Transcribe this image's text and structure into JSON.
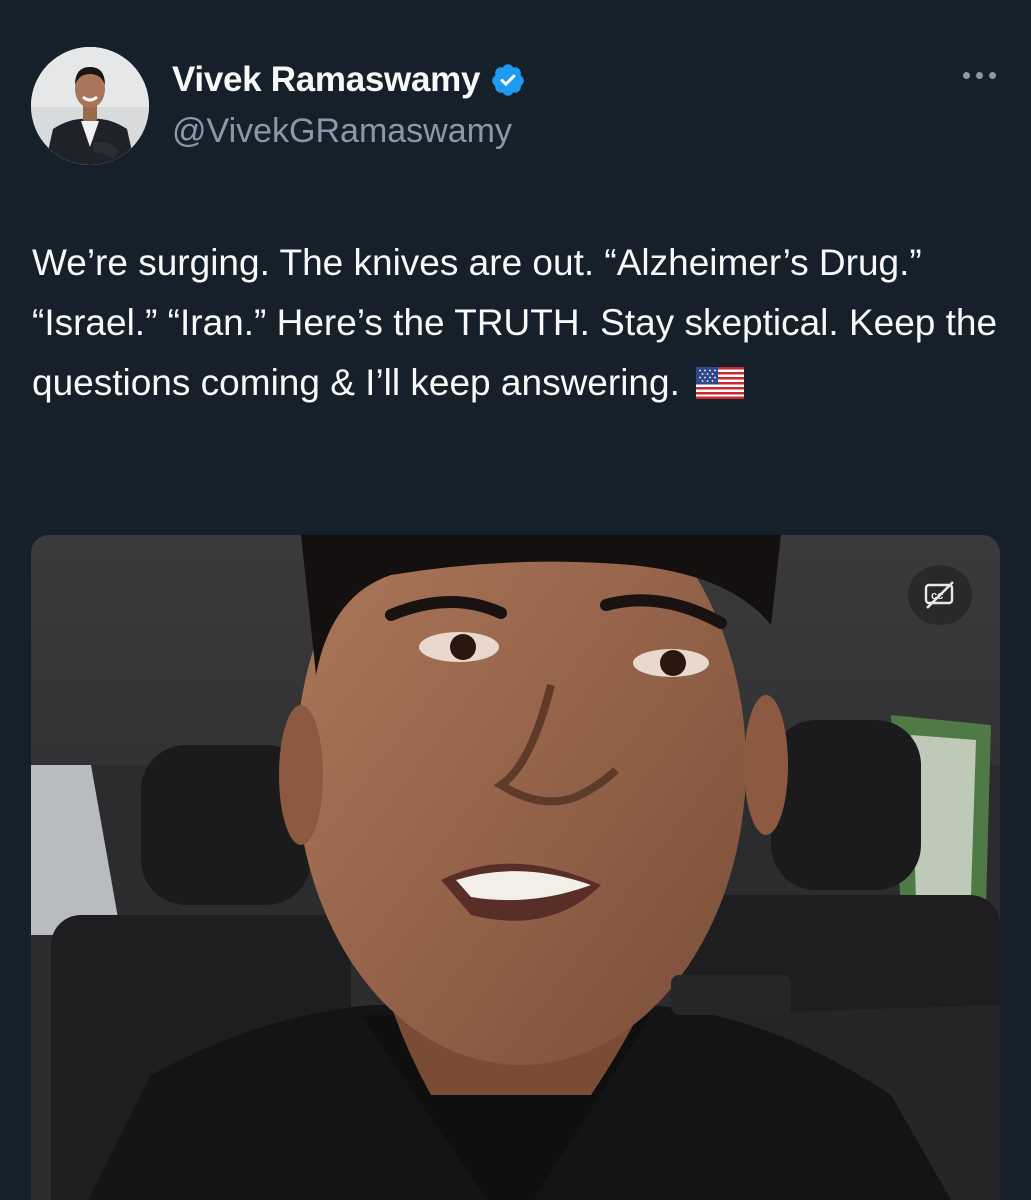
{
  "author": {
    "display_name": "Vivek Ramaswamy",
    "handle": "@VivekGRamaswamy",
    "verified": true,
    "avatar_icon": "profile-photo"
  },
  "tweet": {
    "text": "We’re surging. The knives are out. “Alzheimer’s Drug.” “Israel.” “Iran.” Here’s the TRUTH. Stay skeptical. Keep the questions coming & I’ll keep answering.",
    "emoji": "us-flag"
  },
  "media": {
    "type": "video",
    "caption_toggle_icon": "captions-off-icon"
  },
  "colors": {
    "background": "#15202b",
    "primary_text": "#f7f9f9",
    "secondary_text": "#8b98a5",
    "verified_badge": "#1d9bf0"
  }
}
